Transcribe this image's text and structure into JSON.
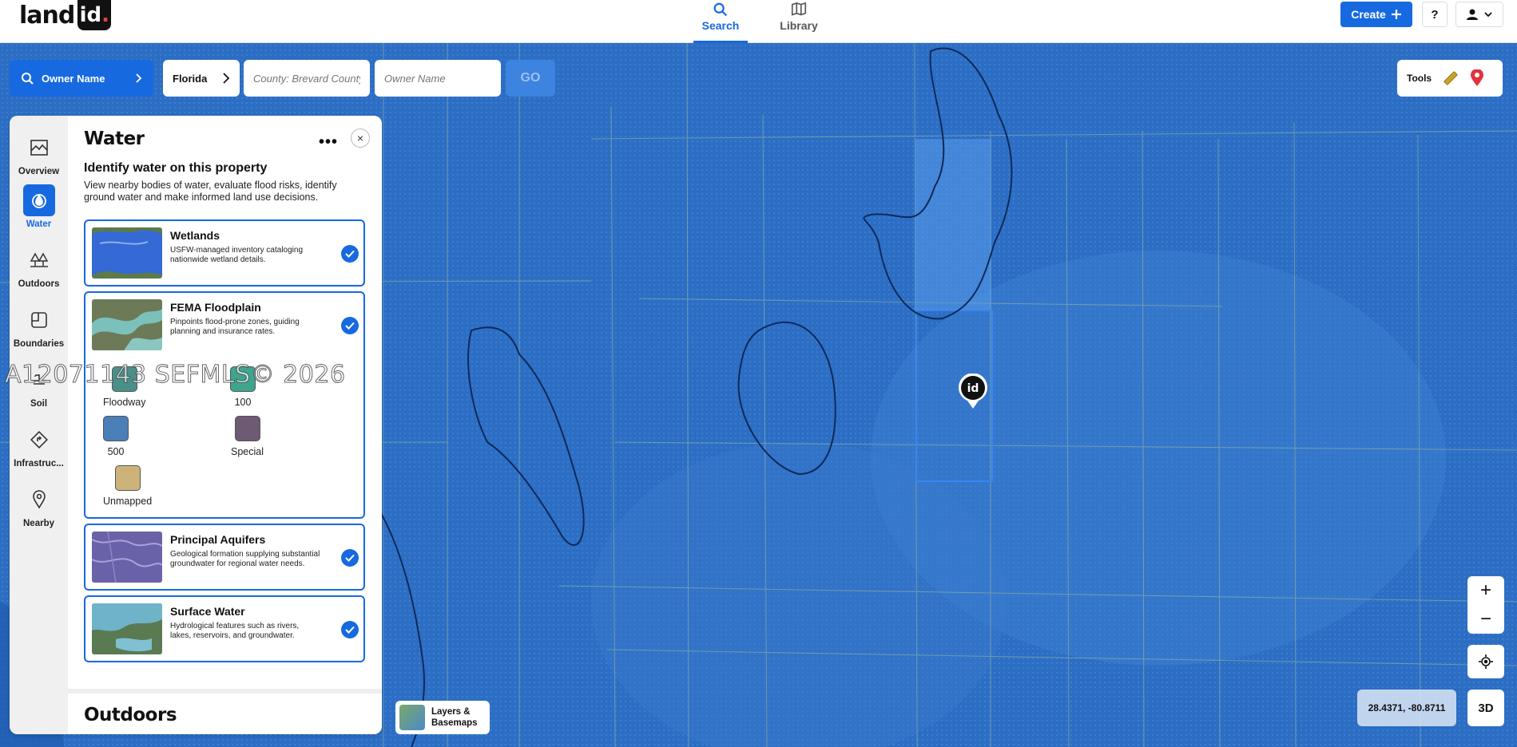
{
  "logo": {
    "word": "land",
    "badge": "id",
    "badge_dot": "."
  },
  "nav": {
    "tabs": [
      {
        "label": "Search",
        "active": true
      },
      {
        "label": "Library",
        "active": false
      }
    ]
  },
  "header_actions": {
    "create_label": "Create",
    "help_label": "?"
  },
  "search": {
    "mode_label": "Owner Name",
    "state_value": "Florida",
    "county_placeholder": "County: Brevard County",
    "owner_placeholder": "Owner Name",
    "go_label": "GO"
  },
  "tools": {
    "label": "Tools"
  },
  "sidebar": {
    "items": [
      {
        "label": "Overview",
        "icon": "map-icon"
      },
      {
        "label": "Water",
        "icon": "water-drop-icon",
        "active": true
      },
      {
        "label": "Outdoors",
        "icon": "trees-icon"
      },
      {
        "label": "Boundaries",
        "icon": "boundary-icon"
      },
      {
        "label": "Soil",
        "icon": "soil-icon"
      },
      {
        "label": "Infrastruc...",
        "icon": "road-sign-icon"
      },
      {
        "label": "Nearby",
        "icon": "location-pin-icon"
      }
    ]
  },
  "panel": {
    "title": "Water",
    "more_label": "•••",
    "close_label": "×",
    "subtitle": "Identify water on this property",
    "description": "View nearby bodies of water, evaluate flood risks, identify ground water and make informed land use decisions.",
    "layers": [
      {
        "title": "Wetlands",
        "description": "USFW-managed inventory cataloging nationwide wetland details.",
        "checked": true
      },
      {
        "title": "FEMA Floodplain",
        "description": "Pinpoints flood-prone zones, guiding planning and insurance rates.",
        "checked": true
      },
      {
        "title": "Principal Aquifers",
        "description": "Geological formation supplying substantial groundwater for regional water needs.",
        "checked": true
      },
      {
        "title": "Surface Water",
        "description": "Hydrological features such as rivers, lakes, reservoirs, and groundwater.",
        "checked": true
      }
    ],
    "flood_legend": [
      {
        "label": "Floodway",
        "color": "#4a8f8a"
      },
      {
        "label": "100",
        "color": "#3fa58f"
      },
      {
        "label": "500",
        "color": "#4b7fb8"
      },
      {
        "label": "Special",
        "color": "#6e5a72"
      },
      {
        "label": "Unmapped",
        "color": "#cdb37a"
      }
    ],
    "next_section": "Outdoors"
  },
  "watermark": "A12071143 SEFMLS© 2026",
  "map_controls": {
    "layers_label_line1": "Layers &",
    "layers_label_line2": "Basemaps",
    "zoom_in": "+",
    "zoom_out": "−",
    "coordinates": "28.4371, -80.8711",
    "view_3d": "3D"
  },
  "pin": {
    "label": "id"
  },
  "colors": {
    "accent": "#1769e0",
    "map_water": "#2b6fc6"
  }
}
